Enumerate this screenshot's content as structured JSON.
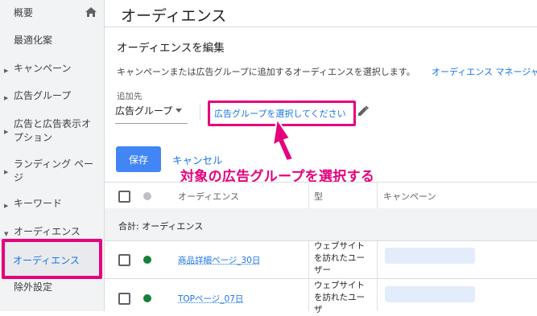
{
  "sidebar": {
    "items": [
      {
        "label": "概要"
      },
      {
        "label": "最適化案"
      },
      {
        "label": "キャンペーン"
      },
      {
        "label": "広告グループ"
      },
      {
        "label": "広告と広告表示オ"
      },
      {
        "label": "プション"
      },
      {
        "label": "ランディング ペー"
      },
      {
        "label": "ジ"
      },
      {
        "label": "キーワード"
      },
      {
        "label": "オーディエンス"
      },
      {
        "label": "オーディエンス"
      },
      {
        "label": "除外設定"
      }
    ]
  },
  "main": {
    "page_title": "オーディエンス",
    "edit_title": "オーディエンスを編集",
    "description": "キャンペーンまたは広告グループに追加するオーディエンスを選択します。",
    "description_link": "オーディエンス マネージャ",
    "add_to_label": "追加先",
    "add_to_value": "広告グループ",
    "choose_link": "広告グループを選択してください",
    "save_label": "保存",
    "cancel_label": "キャンセル"
  },
  "annotation": {
    "text": "対象の広告グループを選択する",
    "color": "#e5007d"
  },
  "table": {
    "headers": [
      "オーディエンス",
      "型",
      "キャンペーン"
    ],
    "total_label": "合計: オーディエンス",
    "rows": [
      {
        "name": "商品詳細ページ_30日",
        "type_lines": [
          "ウェブサイト",
          "を訪れたユー",
          "ザー"
        ]
      },
      {
        "name": "TOPページ_07日",
        "type_lines": [
          "ウェブサイト",
          "を訪れたユー",
          "ザ"
        ]
      }
    ]
  },
  "colors": {
    "accent": "#1a73e8",
    "primary_button": "#4285f4",
    "status_green": "#188038"
  }
}
